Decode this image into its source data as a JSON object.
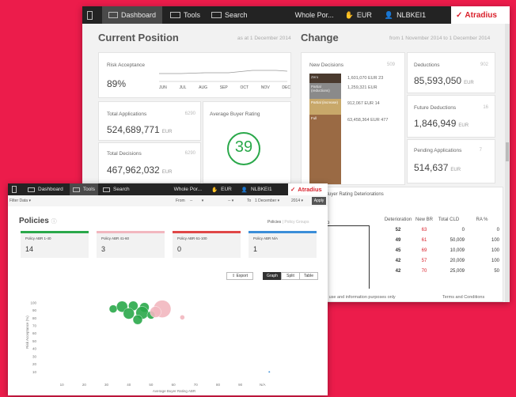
{
  "back": {
    "nav": {
      "dashboard": "Dashboard",
      "tools": "Tools",
      "search": "Search",
      "company": "Whole Por...",
      "currency": "EUR",
      "user": "NLBKEI1",
      "brand": "Atradius"
    },
    "position": {
      "title": "Current Position",
      "as_of": "as at 1 December 2014"
    },
    "change": {
      "title": "Change",
      "range": "from 1 November 2014 to 1 December 2014"
    },
    "risk": {
      "label": "Risk Acceptance",
      "value": "89%",
      "months": [
        "JUN",
        "JUL",
        "AUG",
        "SEP",
        "OCT",
        "NOV",
        "DEC"
      ]
    },
    "applications": {
      "label": "Total Applications",
      "count": "6290",
      "value": "524,689,771",
      "unit": "EUR"
    },
    "decisions": {
      "label": "Total Decisions",
      "count": "6290",
      "value": "467,962,032",
      "unit": "EUR"
    },
    "rating": {
      "label": "Average Buyer Rating",
      "value": "39"
    },
    "new_decisions": {
      "label": "New Decisions",
      "count": "509",
      "rows": [
        {
          "name": "Zero",
          "value": "1,601,070",
          "unit": "EUR",
          "n": "23",
          "color": "#4a3a2e"
        },
        {
          "name": "Partial (reductions)",
          "value": "1,259,321",
          "unit": "EUR",
          "n": "",
          "color": "#8a8a8a"
        },
        {
          "name": "Partial (increase)",
          "value": "912,067",
          "unit": "EUR",
          "n": "14",
          "color": "#c8a86a"
        },
        {
          "name": "Full",
          "value": "63,458,364",
          "unit": "EUR",
          "n": "477",
          "color": "#9a6a44"
        }
      ]
    },
    "deductions": {
      "label": "Deductions",
      "count": "902",
      "value": "85,593,050",
      "unit": "EUR"
    },
    "future_deductions": {
      "label": "Future Deductions",
      "count": "16",
      "value": "1,846,949",
      "unit": "EUR"
    },
    "pending": {
      "label": "Pending Applications",
      "count": "7",
      "value": "514,637",
      "unit": "EUR"
    },
    "deteriorations": {
      "tab": "Buyer Rating Deteriorations",
      "col_name": "ro",
      "headers": [
        "Deterioration",
        "New BR",
        "Total CLD",
        "RA %"
      ],
      "rows": [
        [
          "52",
          "63",
          "0",
          "0"
        ],
        [
          "49",
          "61",
          "50,009",
          "100"
        ],
        [
          "45",
          "69",
          "10,009",
          "100"
        ],
        [
          "42",
          "57",
          "20,009",
          "100"
        ],
        [
          "42",
          "70",
          "25,009",
          "50"
        ]
      ]
    },
    "footer": {
      "left": "d use and information purposes only",
      "right": "Terms and Conditions"
    }
  },
  "front": {
    "nav": {
      "dashboard": "Dashboard",
      "tools": "Tools",
      "search": "Search",
      "company": "Whole Por...",
      "currency": "EUR",
      "user": "NLBKEI1",
      "brand": "Atradius"
    },
    "filter": {
      "label": "Filter Data",
      "from_label": "From",
      "from_value": "--",
      "to_label": "To",
      "to_day": "1 December",
      "to_year": "2014",
      "apply": "Apply"
    },
    "policies": {
      "title": "Policies",
      "link_active": "Policies",
      "link_sep": "|",
      "link_other": "Policy Groups"
    },
    "cards": [
      {
        "label": "Policy ABR 1-40",
        "value": "14",
        "color": "#2aa84a"
      },
      {
        "label": "Policy ABR 41-60",
        "value": "3",
        "color": "#f2b7bf"
      },
      {
        "label": "Policy ABR 61-100",
        "value": "0",
        "color": "#e04747"
      },
      {
        "label": "Policy ABR N/A",
        "value": "1",
        "color": "#3b8ed8"
      }
    ],
    "buttons": {
      "export": "Export",
      "graph": "Graph",
      "split": "Split",
      "table": "Table"
    },
    "chart_data": {
      "type": "scatter",
      "xlabel": "Average Buyer Rating ABR",
      "ylabel": "Risk Acceptance (%)",
      "xlim": [
        0,
        110
      ],
      "ylim": [
        0,
        105
      ],
      "xticks": [
        "10",
        "20",
        "30",
        "40",
        "50",
        "60",
        "70",
        "80",
        "90",
        "N/A"
      ],
      "yticks": [
        "100",
        "90",
        "80",
        "70",
        "60",
        "50",
        "40",
        "30",
        "20",
        "10"
      ],
      "series": [
        {
          "color": "#2aa84a",
          "points": [
            {
              "x": 37,
              "y": 95,
              "r": 7
            },
            {
              "x": 42,
              "y": 96,
              "r": 6
            },
            {
              "x": 47,
              "y": 94,
              "r": 6
            },
            {
              "x": 40,
              "y": 86,
              "r": 7
            },
            {
              "x": 46,
              "y": 87,
              "r": 8
            },
            {
              "x": 50,
              "y": 84,
              "r": 5
            },
            {
              "x": 44,
              "y": 78,
              "r": 6
            },
            {
              "x": 33,
              "y": 92,
              "r": 5
            }
          ]
        },
        {
          "color": "#f2b7bf",
          "points": [
            {
              "x": 55,
              "y": 92,
              "r": 11
            },
            {
              "x": 52,
              "y": 88,
              "r": 7
            },
            {
              "x": 64,
              "y": 81,
              "r": 3
            }
          ]
        },
        {
          "color": "#3b8ed8",
          "points": [
            {
              "x": 103,
              "y": 10,
              "r": 1.2
            }
          ]
        }
      ]
    }
  }
}
